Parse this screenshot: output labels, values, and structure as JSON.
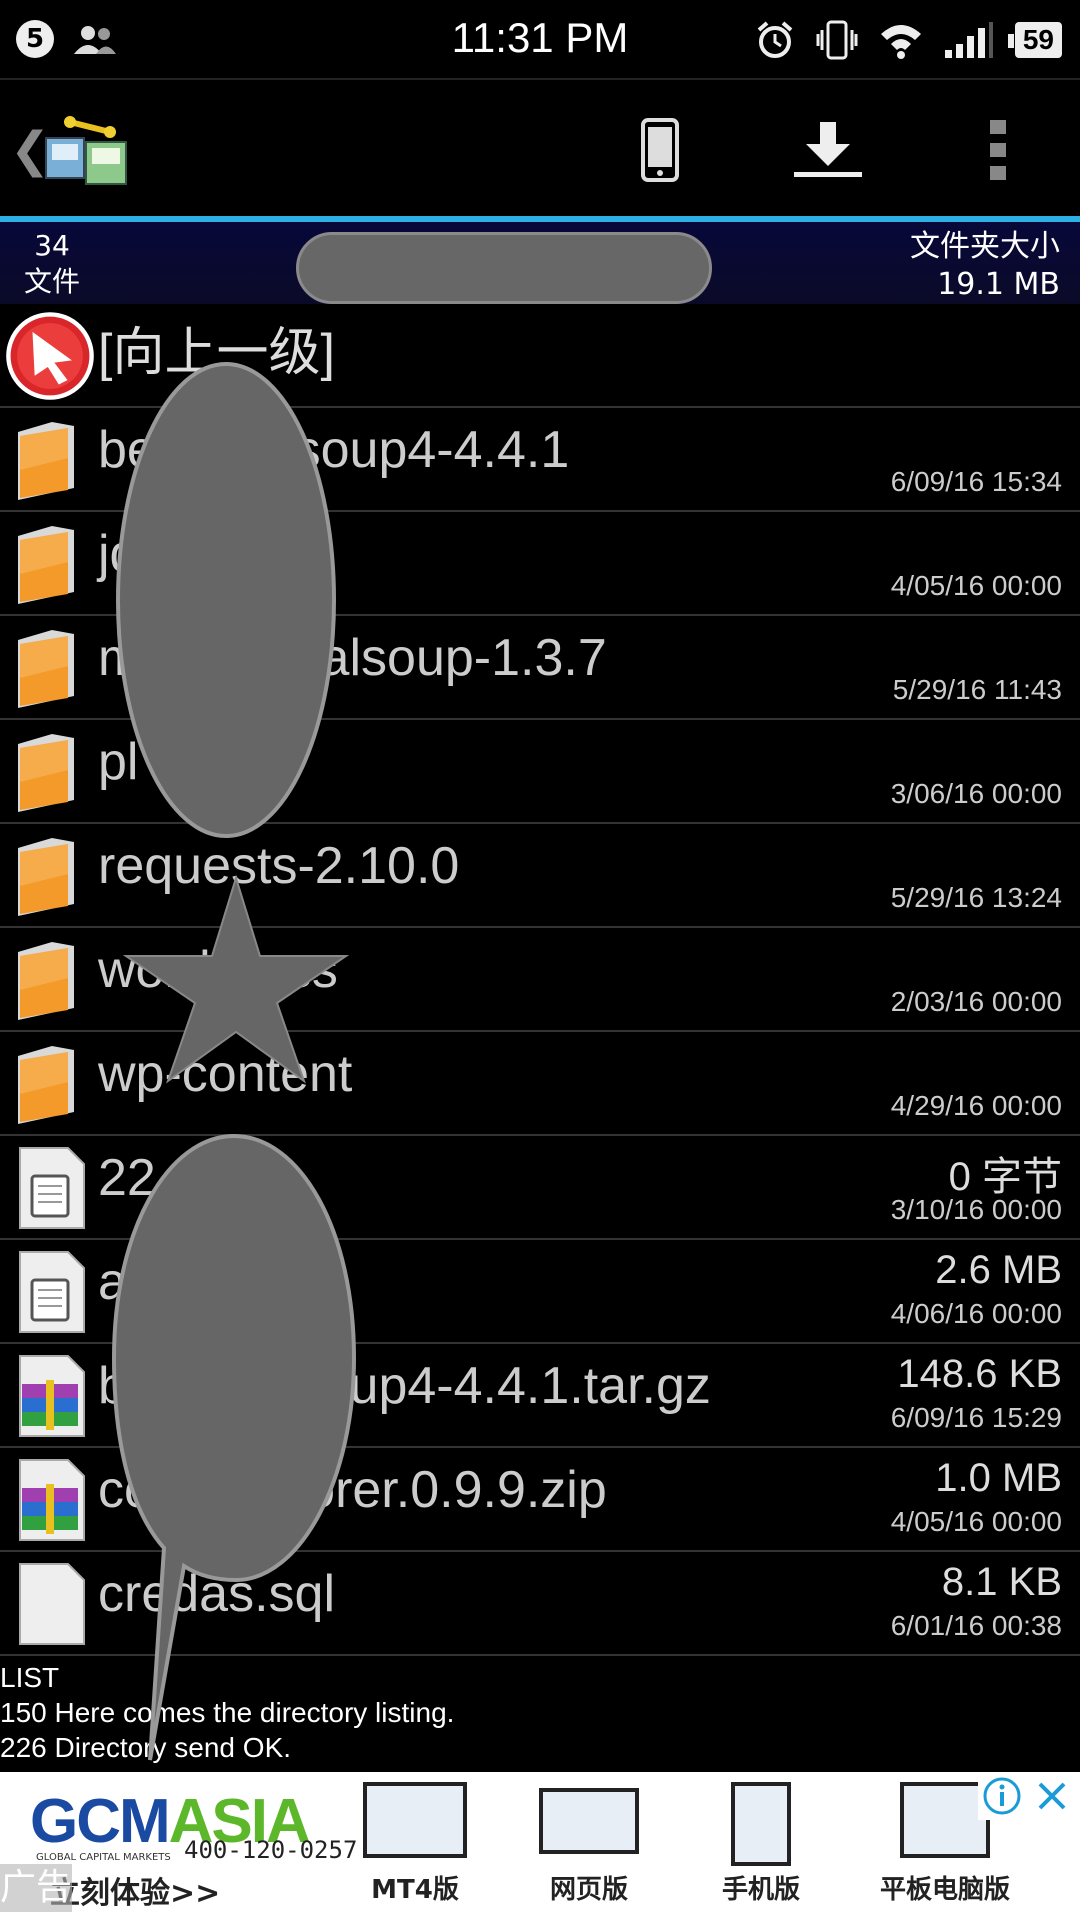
{
  "status_bar": {
    "notification_count": "5",
    "time": "11:31 PM",
    "battery": "59"
  },
  "toolbar": {
    "back": "❮",
    "icons": [
      "phone-icon",
      "download-icon",
      "overflow-menu-icon"
    ]
  },
  "info_bar": {
    "file_count": "34",
    "file_label": "文件",
    "folder_size_label": "文件夹大小",
    "folder_size": "19.1 MB"
  },
  "list": {
    "up_label": "[向上一级]",
    "rows": [
      {
        "name": "beautifulsoup4-4.4.1",
        "size": "",
        "date": "6/09/16 15:34",
        "type": "folder"
      },
      {
        "name": "jd",
        "size": "",
        "date": "4/05/16 00:00",
        "type": "folder"
      },
      {
        "name": "mechanicalsoup-1.3.7",
        "size": "",
        "date": "5/29/16 11:43",
        "type": "folder"
      },
      {
        "name": "pl",
        "size": "",
        "date": "3/06/16 00:00",
        "type": "folder"
      },
      {
        "name": "requests-2.10.0",
        "size": "",
        "date": "5/29/16 13:24",
        "type": "folder"
      },
      {
        "name": "wordpress",
        "size": "",
        "date": "2/03/16 00:00",
        "type": "folder"
      },
      {
        "name": "wp-content",
        "size": "",
        "date": "4/29/16 00:00",
        "type": "folder"
      },
      {
        "name": "22",
        "size": "0 字节",
        "date": "3/10/16 00:00",
        "type": "doc"
      },
      {
        "name": "access.log",
        "size": "2.6 MB",
        "date": "4/06/16 00:00",
        "type": "doc"
      },
      {
        "name": "beautifulsoup4-4.4.1.tar.gz",
        "size": "148.6 KB",
        "date": "6/09/16 15:29",
        "type": "archive"
      },
      {
        "name": "codeexplorer.0.9.9.zip",
        "size": "1.0 MB",
        "date": "4/05/16 00:00",
        "type": "archive"
      },
      {
        "name": "credas.sql",
        "size": "8.1 KB",
        "date": "6/01/16 00:38",
        "type": "blank"
      }
    ]
  },
  "console": {
    "lines": [
      "LIST",
      "150 Here comes the directory listing.",
      "226 Directory send OK."
    ]
  },
  "ad": {
    "brand_left": "GCM",
    "brand_right": "ASIA",
    "tagline": "GLOBAL CAPITAL MARKETS",
    "phone": "400-120-0257",
    "cta": "立刻体验>>",
    "products": [
      "MT4版",
      "网页版",
      "手机版",
      "平板电脑版"
    ],
    "ad_label": "广告"
  },
  "colors": {
    "accent": "#2db0e6",
    "info_bar": "#08083a",
    "folder_orange": "#f39a2a"
  }
}
